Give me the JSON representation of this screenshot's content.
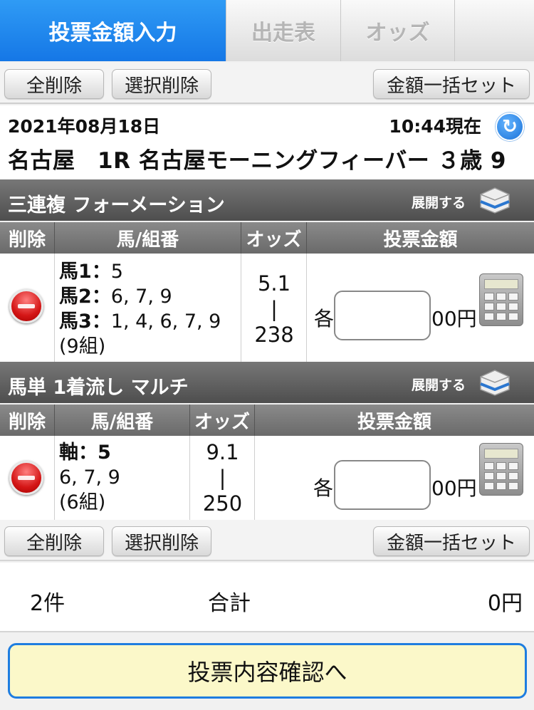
{
  "tabs": [
    {
      "label": "投票金額入力",
      "active": true
    },
    {
      "label": "出走表",
      "active": false
    },
    {
      "label": "オッズ",
      "active": false
    },
    {
      "label": "",
      "active": false
    }
  ],
  "toolbar": {
    "delete_all": "全削除",
    "delete_selected": "選択削除",
    "set_amount_all": "金額一括セット"
  },
  "race": {
    "date": "2021年08月18日",
    "time_now": "10:44現在",
    "name": "名古屋　1R 名古屋モーニングフィーバー ３歳 9"
  },
  "bets": [
    {
      "title": "三連複 フォーメーション",
      "expand_label": "展開する",
      "columns": [
        "削除",
        "馬/組番",
        "オッズ",
        "投票金額"
      ],
      "lines": [
        {
          "label": "馬1：",
          "value": "5"
        },
        {
          "label": "馬2：",
          "value": "6, 7, 9"
        },
        {
          "label": "馬3：",
          "value": "1, 4, 6, 7, 9"
        }
      ],
      "count": "(9組)",
      "odds_low": "5.1",
      "odds_sep": "|",
      "odds_high": "238",
      "each_label": "各",
      "amount_value": "",
      "unit": "00円"
    },
    {
      "title": "馬単 1着流し マルチ",
      "expand_label": "展開する",
      "columns": [
        "削除",
        "馬/組番",
        "オッズ",
        "投票金額"
      ],
      "lines": [
        {
          "label": "軸：5",
          "value": ""
        },
        {
          "label": "",
          "value": "6, 7, 9"
        }
      ],
      "count": "(6組)",
      "odds_low": "9.1",
      "odds_sep": "|",
      "odds_high": "250",
      "each_label": "各",
      "amount_value": "",
      "unit": "00円"
    }
  ],
  "summary": {
    "count": "2件",
    "label": "合計",
    "total": "0円"
  },
  "confirm_label": "投票内容確認へ",
  "colors": {
    "tab_active": "#1a7fe8",
    "header_gray": "#5f5f5f",
    "confirm_bg": "#fbf8c9",
    "confirm_border": "#1e7de0"
  }
}
